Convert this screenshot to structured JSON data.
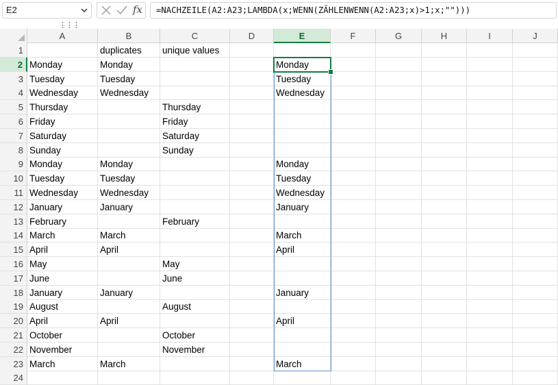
{
  "formula_bar": {
    "name_box": "E2",
    "fx_label": "fx",
    "formula": "=NACHZEILE(A2:A23;LAMBDA(x;WENN(ZÄHLENWENN(A2:A23;x)>1;x;\"\")))"
  },
  "columns": [
    "A",
    "B",
    "C",
    "D",
    "E",
    "F",
    "G",
    "H",
    "I",
    "J"
  ],
  "selected_column": "E",
  "selected_row": 2,
  "rows": [
    {
      "num": "1",
      "A": "",
      "B": "duplicates",
      "C": "unique values",
      "E": ""
    },
    {
      "num": "2",
      "A": "Monday",
      "B": "Monday",
      "C": "",
      "E": "Monday"
    },
    {
      "num": "3",
      "A": "Tuesday",
      "B": "Tuesday",
      "C": "",
      "E": "Tuesday"
    },
    {
      "num": "4",
      "A": "Wednesday",
      "B": "Wednesday",
      "C": "",
      "E": "Wednesday"
    },
    {
      "num": "5",
      "A": "Thursday",
      "B": "",
      "C": "Thursday",
      "E": ""
    },
    {
      "num": "6",
      "A": "Friday",
      "B": "",
      "C": "Friday",
      "E": ""
    },
    {
      "num": "7",
      "A": "Saturday",
      "B": "",
      "C": "Saturday",
      "E": ""
    },
    {
      "num": "8",
      "A": "Sunday",
      "B": "",
      "C": "Sunday",
      "E": ""
    },
    {
      "num": "9",
      "A": "Monday",
      "B": "Monday",
      "C": "",
      "E": "Monday"
    },
    {
      "num": "10",
      "A": "Tuesday",
      "B": "Tuesday",
      "C": "",
      "E": "Tuesday"
    },
    {
      "num": "11",
      "A": "Wednesday",
      "B": "Wednesday",
      "C": "",
      "E": "Wednesday"
    },
    {
      "num": "12",
      "A": "January",
      "B": "January",
      "C": "",
      "E": "January"
    },
    {
      "num": "13",
      "A": "February",
      "B": "",
      "C": "February",
      "E": ""
    },
    {
      "num": "14",
      "A": "March",
      "B": "March",
      "C": "",
      "E": "March"
    },
    {
      "num": "15",
      "A": "April",
      "B": "April",
      "C": "",
      "E": "April"
    },
    {
      "num": "16",
      "A": "May",
      "B": "",
      "C": "May",
      "E": ""
    },
    {
      "num": "17",
      "A": "June",
      "B": "",
      "C": "June",
      "E": ""
    },
    {
      "num": "18",
      "A": "January",
      "B": "January",
      "C": "",
      "E": "January"
    },
    {
      "num": "19",
      "A": "August",
      "B": "",
      "C": "August",
      "E": ""
    },
    {
      "num": "20",
      "A": "April",
      "B": "April",
      "C": "",
      "E": "April"
    },
    {
      "num": "21",
      "A": "October",
      "B": "",
      "C": "October",
      "E": ""
    },
    {
      "num": "22",
      "A": "November",
      "B": "",
      "C": "November",
      "E": ""
    },
    {
      "num": "23",
      "A": "March",
      "B": "March",
      "C": "",
      "E": "March"
    },
    {
      "num": "24",
      "A": "",
      "B": "",
      "C": "",
      "E": ""
    }
  ],
  "colors": {
    "selection": "#107c41",
    "spill_border": "#5b8fd6",
    "header_bg": "#f3f3f3"
  }
}
